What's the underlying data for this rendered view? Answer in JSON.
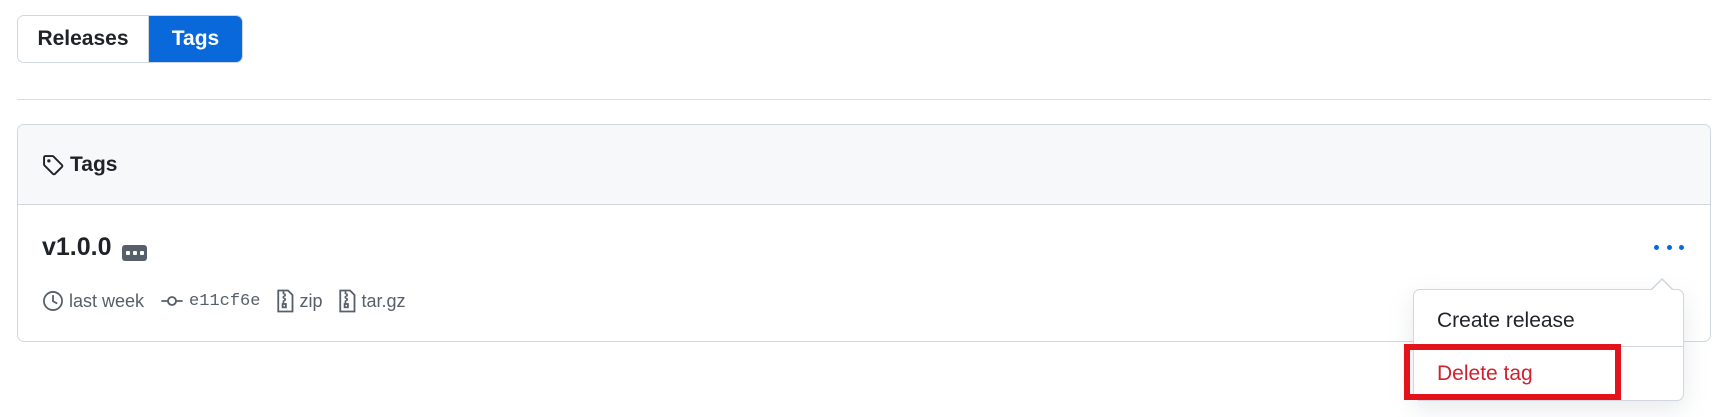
{
  "segmented": {
    "releases_label": "Releases",
    "tags_label": "Tags",
    "active": "Tags",
    "active_color": "#0969da"
  },
  "box": {
    "header_title": "Tags",
    "header_icon": "tag-icon"
  },
  "tag": {
    "name": "v1.0.0",
    "relative_time": "last week",
    "commit": "e11cf6e",
    "zip_label": "zip",
    "targz_label": "tar.gz"
  },
  "menu": {
    "create_release": "Create release",
    "delete_tag": "Delete tag",
    "danger_color": "#cf222e",
    "highlight_color": "#e3131b"
  }
}
